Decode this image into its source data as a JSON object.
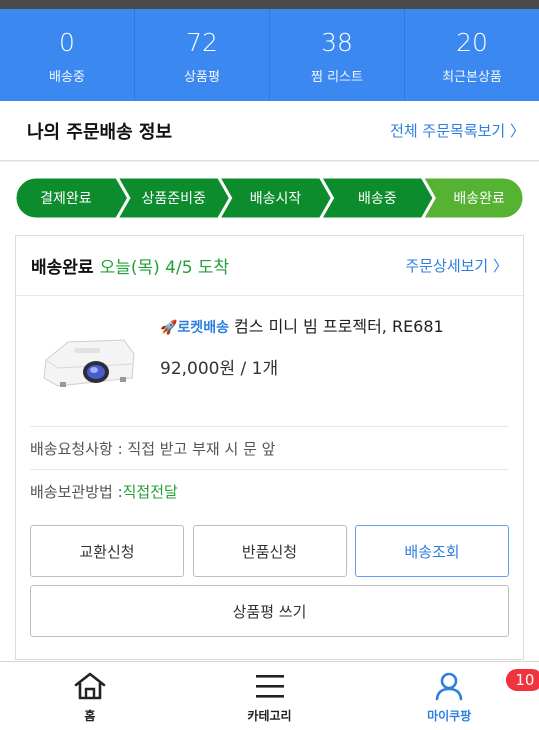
{
  "stats": [
    {
      "count": "0",
      "label": "배송중"
    },
    {
      "count": "72",
      "label": "상품평"
    },
    {
      "count": "38",
      "label": "찜 리스트"
    },
    {
      "count": "20",
      "label": "최근본상품"
    }
  ],
  "order_info": {
    "title": "나의 주문배송 정보",
    "link": "전체 주문목록보기 〉"
  },
  "steps": [
    "결제완료",
    "상품준비중",
    "배송시작",
    "배송중",
    "배송완료"
  ],
  "steps_active_index": 4,
  "colors": {
    "step_green": "#0d8c2e",
    "step_active": "#55b233",
    "accent_blue": "#2f7fe0",
    "badge_red": "#f0333c"
  },
  "card": {
    "status": "배송완료",
    "arrival": "오늘(목) 4/5 도착",
    "detail_link": "주문상세보기 〉",
    "product": {
      "rocket_label": "🚀로켓배송",
      "name": "컴스 미니 빔 프로젝터, RE681",
      "price": "92,000원 / 1개"
    },
    "request_label": "배송요청사항 : 직접 받고 부재 시 문 앞",
    "storage_label": "배송보관방법 : ",
    "storage_value": "직접전달",
    "buttons": {
      "exchange": "교환신청",
      "return": "반품신청",
      "track": "배송조회",
      "review": "상품평 쓰기"
    }
  },
  "tabbar": {
    "home": "홈",
    "category": "카테고리",
    "mycoupang": "마이쿠팡",
    "badge": "10"
  },
  "icons": [
    "home-icon",
    "menu-icon",
    "user-icon",
    "projector-icon"
  ]
}
